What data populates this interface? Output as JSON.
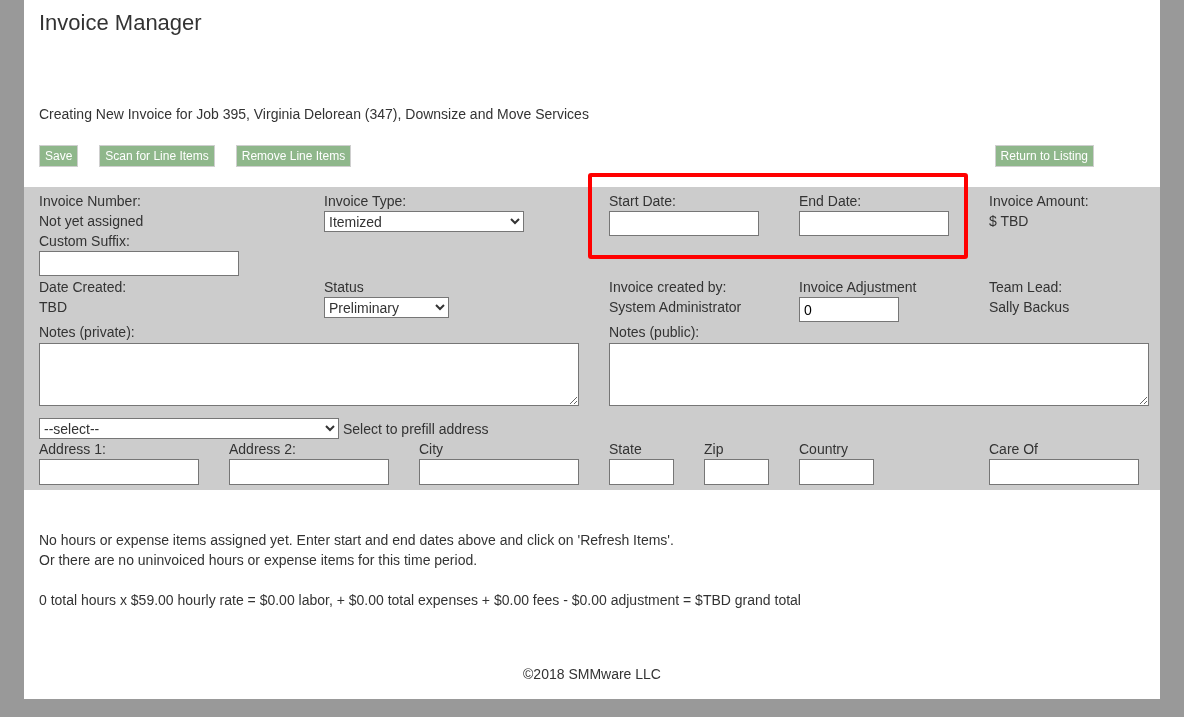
{
  "app_title": "Invoice Manager",
  "heading": "Creating New Invoice for Job 395, Virginia Delorean (347), Downsize and Move Services",
  "toolbar": {
    "left_buttons": [
      "Save",
      "Scan for Line Items",
      "Remove Line Items"
    ],
    "right_buttons": [
      "Return to Listing"
    ]
  },
  "form": {
    "invoice_number": {
      "label": "Invoice Number:",
      "value": "Not yet assigned"
    },
    "custom_suffix": {
      "label": "Custom Suffix:"
    },
    "invoice_type": {
      "label": "Invoice Type:",
      "value": "Itemized"
    },
    "start_date": {
      "label": "Start Date:"
    },
    "end_date": {
      "label": "End Date:"
    },
    "invoice_amount": {
      "label": "Invoice Amount:",
      "value": "$ TBD"
    },
    "date_created": {
      "label": "Date Created:",
      "value": "TBD"
    },
    "status": {
      "label": "Status",
      "value": "Preliminary"
    },
    "created_by": {
      "label": "Invoice created by:",
      "value": "System Administrator"
    },
    "adjustment": {
      "label": "Invoice Adjustment",
      "value": "0"
    },
    "team_lead": {
      "label": "Team Lead:",
      "value": "Sally Backus"
    },
    "notes_private": {
      "label": "Notes (private):"
    },
    "notes_public": {
      "label": "Notes (public):"
    },
    "prefill": {
      "value": "--select--",
      "hint": "Select to prefill address"
    },
    "address_fields": [
      {
        "label": "Address 1:"
      },
      {
        "label": "Address 2:"
      },
      {
        "label": "City"
      },
      {
        "label": "State"
      },
      {
        "label": "Zip"
      },
      {
        "label": "Country"
      },
      {
        "label": "Care Of"
      }
    ]
  },
  "messages": [
    "No hours or expense items assigned yet. Enter start and end dates above and click on 'Refresh Items'.",
    "Or there are no uninvoiced hours or expense items for this time period."
  ],
  "totals": "0 total hours x $59.00 hourly rate = $0.00 labor, + $0.00 total expenses + $0.00 fees - $0.00 adjustment = $TBD grand total",
  "footer": "©2018 SMMware LLC"
}
